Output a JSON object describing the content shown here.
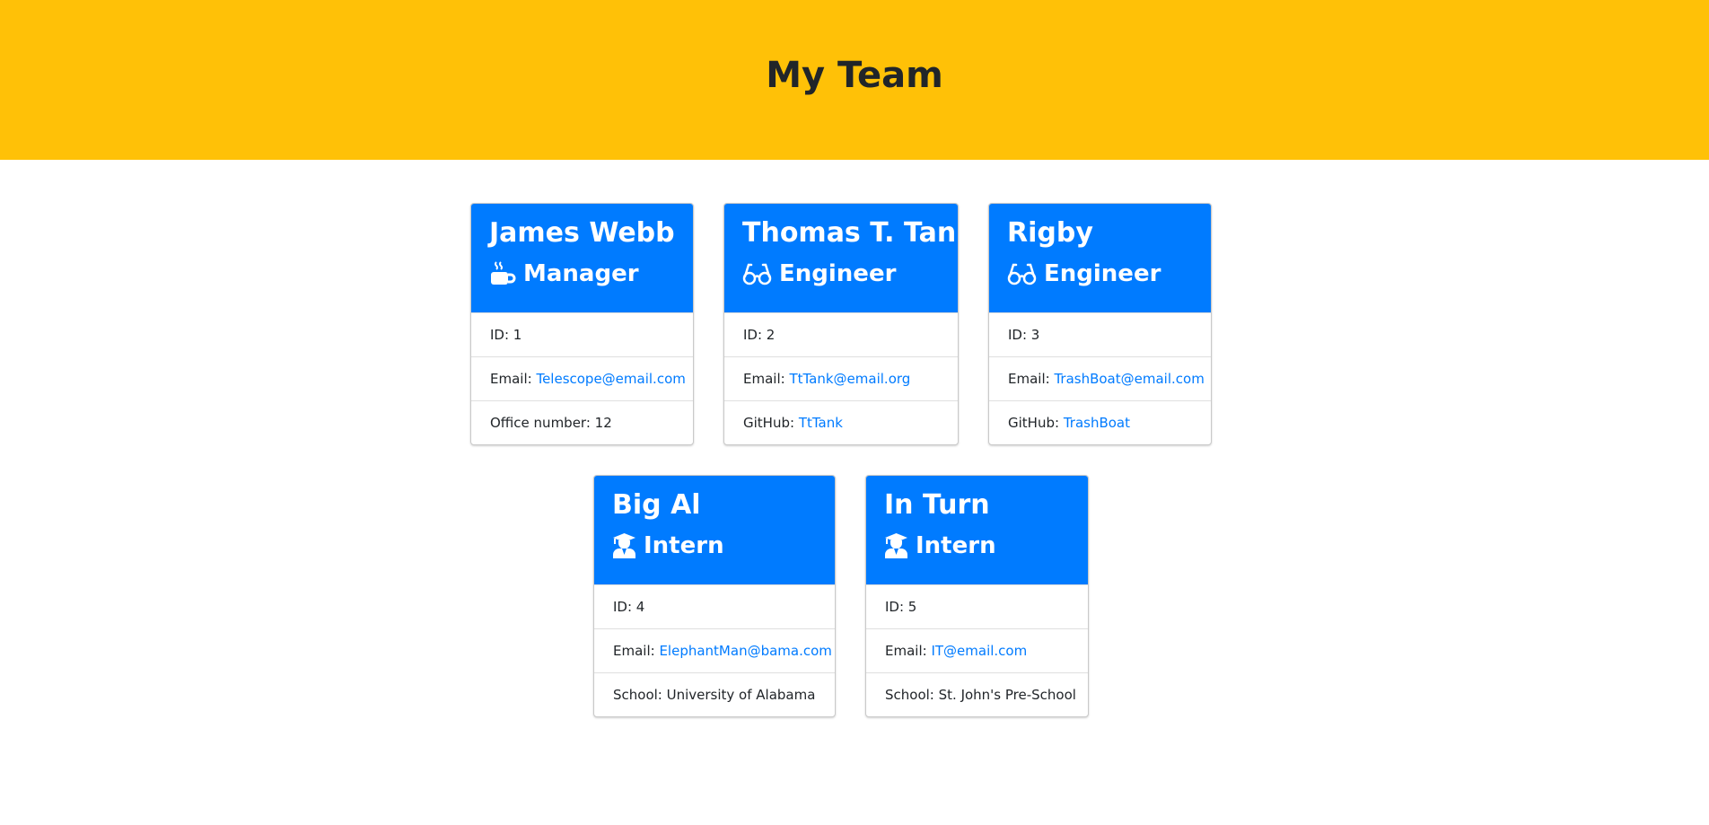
{
  "header": {
    "title": "My Team"
  },
  "cards": [
    {
      "name": "James Webb",
      "role": "Manager",
      "role_icon": "coffee-icon",
      "rows": [
        {
          "label": "ID: ",
          "value": "1"
        },
        {
          "label": "Email: ",
          "value": "Telescope@email.com"
        },
        {
          "label": "Office number: ",
          "value": "12"
        }
      ]
    },
    {
      "name": "Thomas T. Tank",
      "role": "Engineer",
      "role_icon": "glasses-icon",
      "rows": [
        {
          "label": "ID: ",
          "value": "2"
        },
        {
          "label": "Email: ",
          "value": "TtTank@email.org"
        },
        {
          "label": "GitHub: ",
          "value": "TtTank"
        }
      ]
    },
    {
      "name": "Rigby",
      "role": "Engineer",
      "role_icon": "glasses-icon",
      "rows": [
        {
          "label": "ID: ",
          "value": "3"
        },
        {
          "label": "Email: ",
          "value": "TrashBoat@email.com"
        },
        {
          "label": "GitHub: ",
          "value": "TrashBoat"
        }
      ]
    },
    {
      "name": "Big Al",
      "role": "Intern",
      "role_icon": "graduate-icon",
      "rows": [
        {
          "label": "ID: ",
          "value": "4"
        },
        {
          "label": "Email: ",
          "value": "ElephantMan@bama.com"
        },
        {
          "label": "School: ",
          "value": "University of Alabama"
        }
      ]
    },
    {
      "name": "In Turn",
      "role": "Intern",
      "role_icon": "graduate-icon",
      "rows": [
        {
          "label": "ID: ",
          "value": "5"
        },
        {
          "label": "Email: ",
          "value": "IT@email.com"
        },
        {
          "label": "School: ",
          "value": "St. John's Pre-School"
        }
      ]
    }
  ]
}
